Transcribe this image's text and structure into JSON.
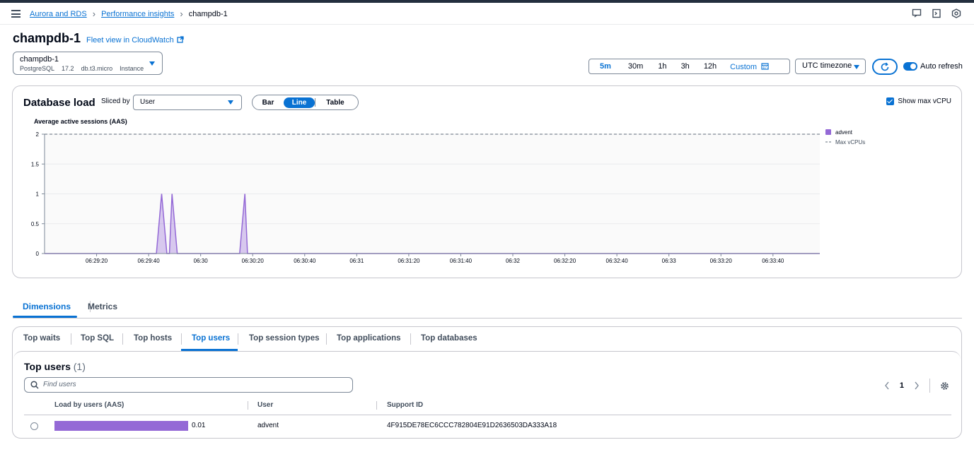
{
  "breadcrumb": {
    "items": [
      "Aurora and RDS",
      "Performance insights"
    ],
    "current": "champdb-1"
  },
  "header": {
    "title": "champdb-1",
    "fleet_link": "Fleet view in CloudWatch"
  },
  "instance": {
    "name": "champdb-1",
    "engine": "PostgreSQL",
    "version": "17.2",
    "class": "db.t3.micro",
    "role": "Instance"
  },
  "time_range": {
    "options": [
      "5m",
      "30m",
      "1h",
      "3h",
      "12h"
    ],
    "custom": "Custom",
    "selected": "5m"
  },
  "timezone": "UTC timezone",
  "auto_refresh": {
    "label": "Auto refresh",
    "on": true
  },
  "db_load": {
    "title": "Database load",
    "sliced_by_label": "Sliced by",
    "sliced_by_value": "User",
    "views": [
      "Bar",
      "Line",
      "Table"
    ],
    "selected_view": "Line",
    "show_max_vcpu": "Show max vCPU"
  },
  "chart_data": {
    "type": "area",
    "ylabel": "Average active sessions (AAS)",
    "ylim": [
      0,
      2
    ],
    "y_ticks": [
      "0",
      "0.5",
      "1",
      "1.5",
      "2"
    ],
    "x_ticks": [
      "06:29:20",
      "06:29:40",
      "06:30",
      "06:30:20",
      "06:30:40",
      "06:31",
      "06:31:20",
      "06:31:40",
      "06:32",
      "06:32:20",
      "06:32:40",
      "06:33",
      "06:33:20",
      "06:33:40"
    ],
    "x_start": "06:29:00",
    "x_end": "06:33:58",
    "series": [
      {
        "name": "advent",
        "color": "#9469d6",
        "points": [
          [
            "06:29:00",
            0
          ],
          [
            "06:29:43",
            0
          ],
          [
            "06:29:45",
            1
          ],
          [
            "06:29:47",
            0
          ],
          [
            "06:29:48",
            0
          ],
          [
            "06:29:49",
            1
          ],
          [
            "06:29:51",
            0
          ],
          [
            "06:30:15",
            0
          ],
          [
            "06:30:17",
            1
          ],
          [
            "06:30:18",
            0
          ],
          [
            "06:33:58",
            0
          ]
        ]
      }
    ],
    "max_vcpus": {
      "name": "Max vCPUs",
      "value": 2
    },
    "grid": true,
    "legend": "right"
  },
  "tabs": [
    "Dimensions",
    "Metrics"
  ],
  "dimension_tabs": [
    "Top waits",
    "Top SQL",
    "Top hosts",
    "Top users",
    "Top session types",
    "Top applications",
    "Top databases"
  ],
  "top_users": {
    "title": "Top users",
    "count": "(1)",
    "search_placeholder": "Find users",
    "page": "1",
    "columns": [
      "Load by users (AAS)",
      "User",
      "Support ID"
    ],
    "rows": [
      {
        "load": "0.01",
        "load_fraction": 1.0,
        "user": "advent",
        "support_id": "4F915DE78EC6CCC782804E91D2636503DA333A18"
      }
    ]
  }
}
